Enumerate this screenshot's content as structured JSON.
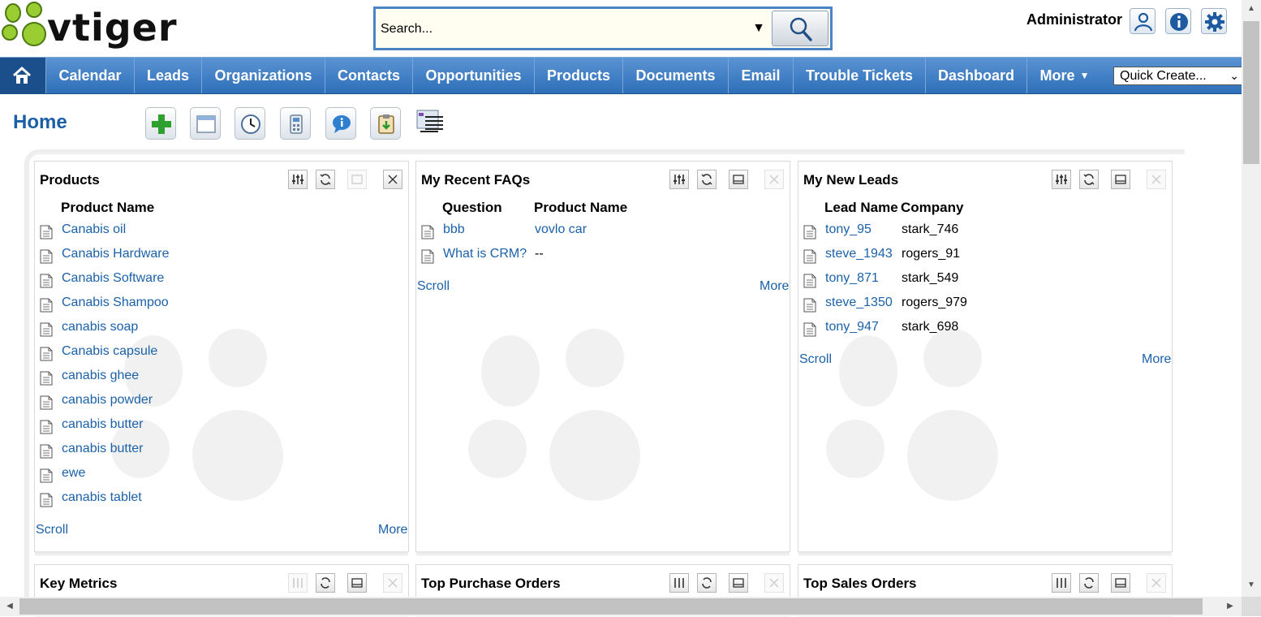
{
  "header": {
    "logo_text": "vtiger",
    "search_placeholder": "Search...",
    "user_name": "Administrator",
    "icons": [
      "user-profile-icon",
      "info-icon",
      "settings-gear-icon"
    ]
  },
  "nav": {
    "home_icon": "home-icon",
    "items": [
      "Calendar",
      "Leads",
      "Organizations",
      "Contacts",
      "Opportunities",
      "Products",
      "Documents",
      "Email",
      "Trouble Tickets",
      "Dashboard",
      "More"
    ],
    "quick_create": "Quick Create..."
  },
  "page": {
    "title": "Home",
    "toolbar": [
      "add-widget-icon",
      "window-icon",
      "clock-icon",
      "calculator-icon",
      "chat-bubble-icon",
      "clipboard-import-icon",
      "list-view-icon"
    ]
  },
  "widgets": {
    "products": {
      "title": "Products",
      "col": "Product Name",
      "rows": [
        "Canabis oil",
        "Canabis Hardware",
        "Canabis Software",
        "Canabis Shampoo",
        "canabis soap",
        "Canabis capsule",
        "canabis ghee",
        "canabis powder",
        "canabis butter",
        "canabis butter",
        "ewe",
        "canabis tablet"
      ],
      "scroll": "Scroll",
      "more": "More"
    },
    "faqs": {
      "title": "My Recent FAQs",
      "col1": "Question",
      "col2": "Product Name",
      "rows": [
        {
          "question": "bbb",
          "product": "vovlo car"
        },
        {
          "question": "What is CRM?",
          "product": "--"
        }
      ],
      "scroll": "Scroll",
      "more": "More"
    },
    "leads": {
      "title": "My New Leads",
      "col1": "Lead Name",
      "col2": "Company",
      "rows": [
        {
          "name": "tony_95",
          "company": "stark_746"
        },
        {
          "name": "steve_1943",
          "company": "rogers_91"
        },
        {
          "name": "tony_871",
          "company": "stark_549"
        },
        {
          "name": "steve_1350",
          "company": "rogers_979"
        },
        {
          "name": "tony_947",
          "company": "stark_698"
        }
      ],
      "scroll": "Scroll",
      "more": "More"
    },
    "key_metrics": {
      "title": "Key Metrics"
    },
    "top_purchase_orders": {
      "title": "Top Purchase Orders"
    },
    "top_sales_orders": {
      "title": "Top Sales Orders"
    }
  },
  "widget_buttons": [
    "settings-sliders-icon",
    "refresh-icon",
    "minimize-icon",
    "close-icon"
  ],
  "colors": {
    "nav_blue": "#2d6fb8",
    "link_blue": "#1b61a9",
    "title_blue": "#1b5fa8"
  }
}
